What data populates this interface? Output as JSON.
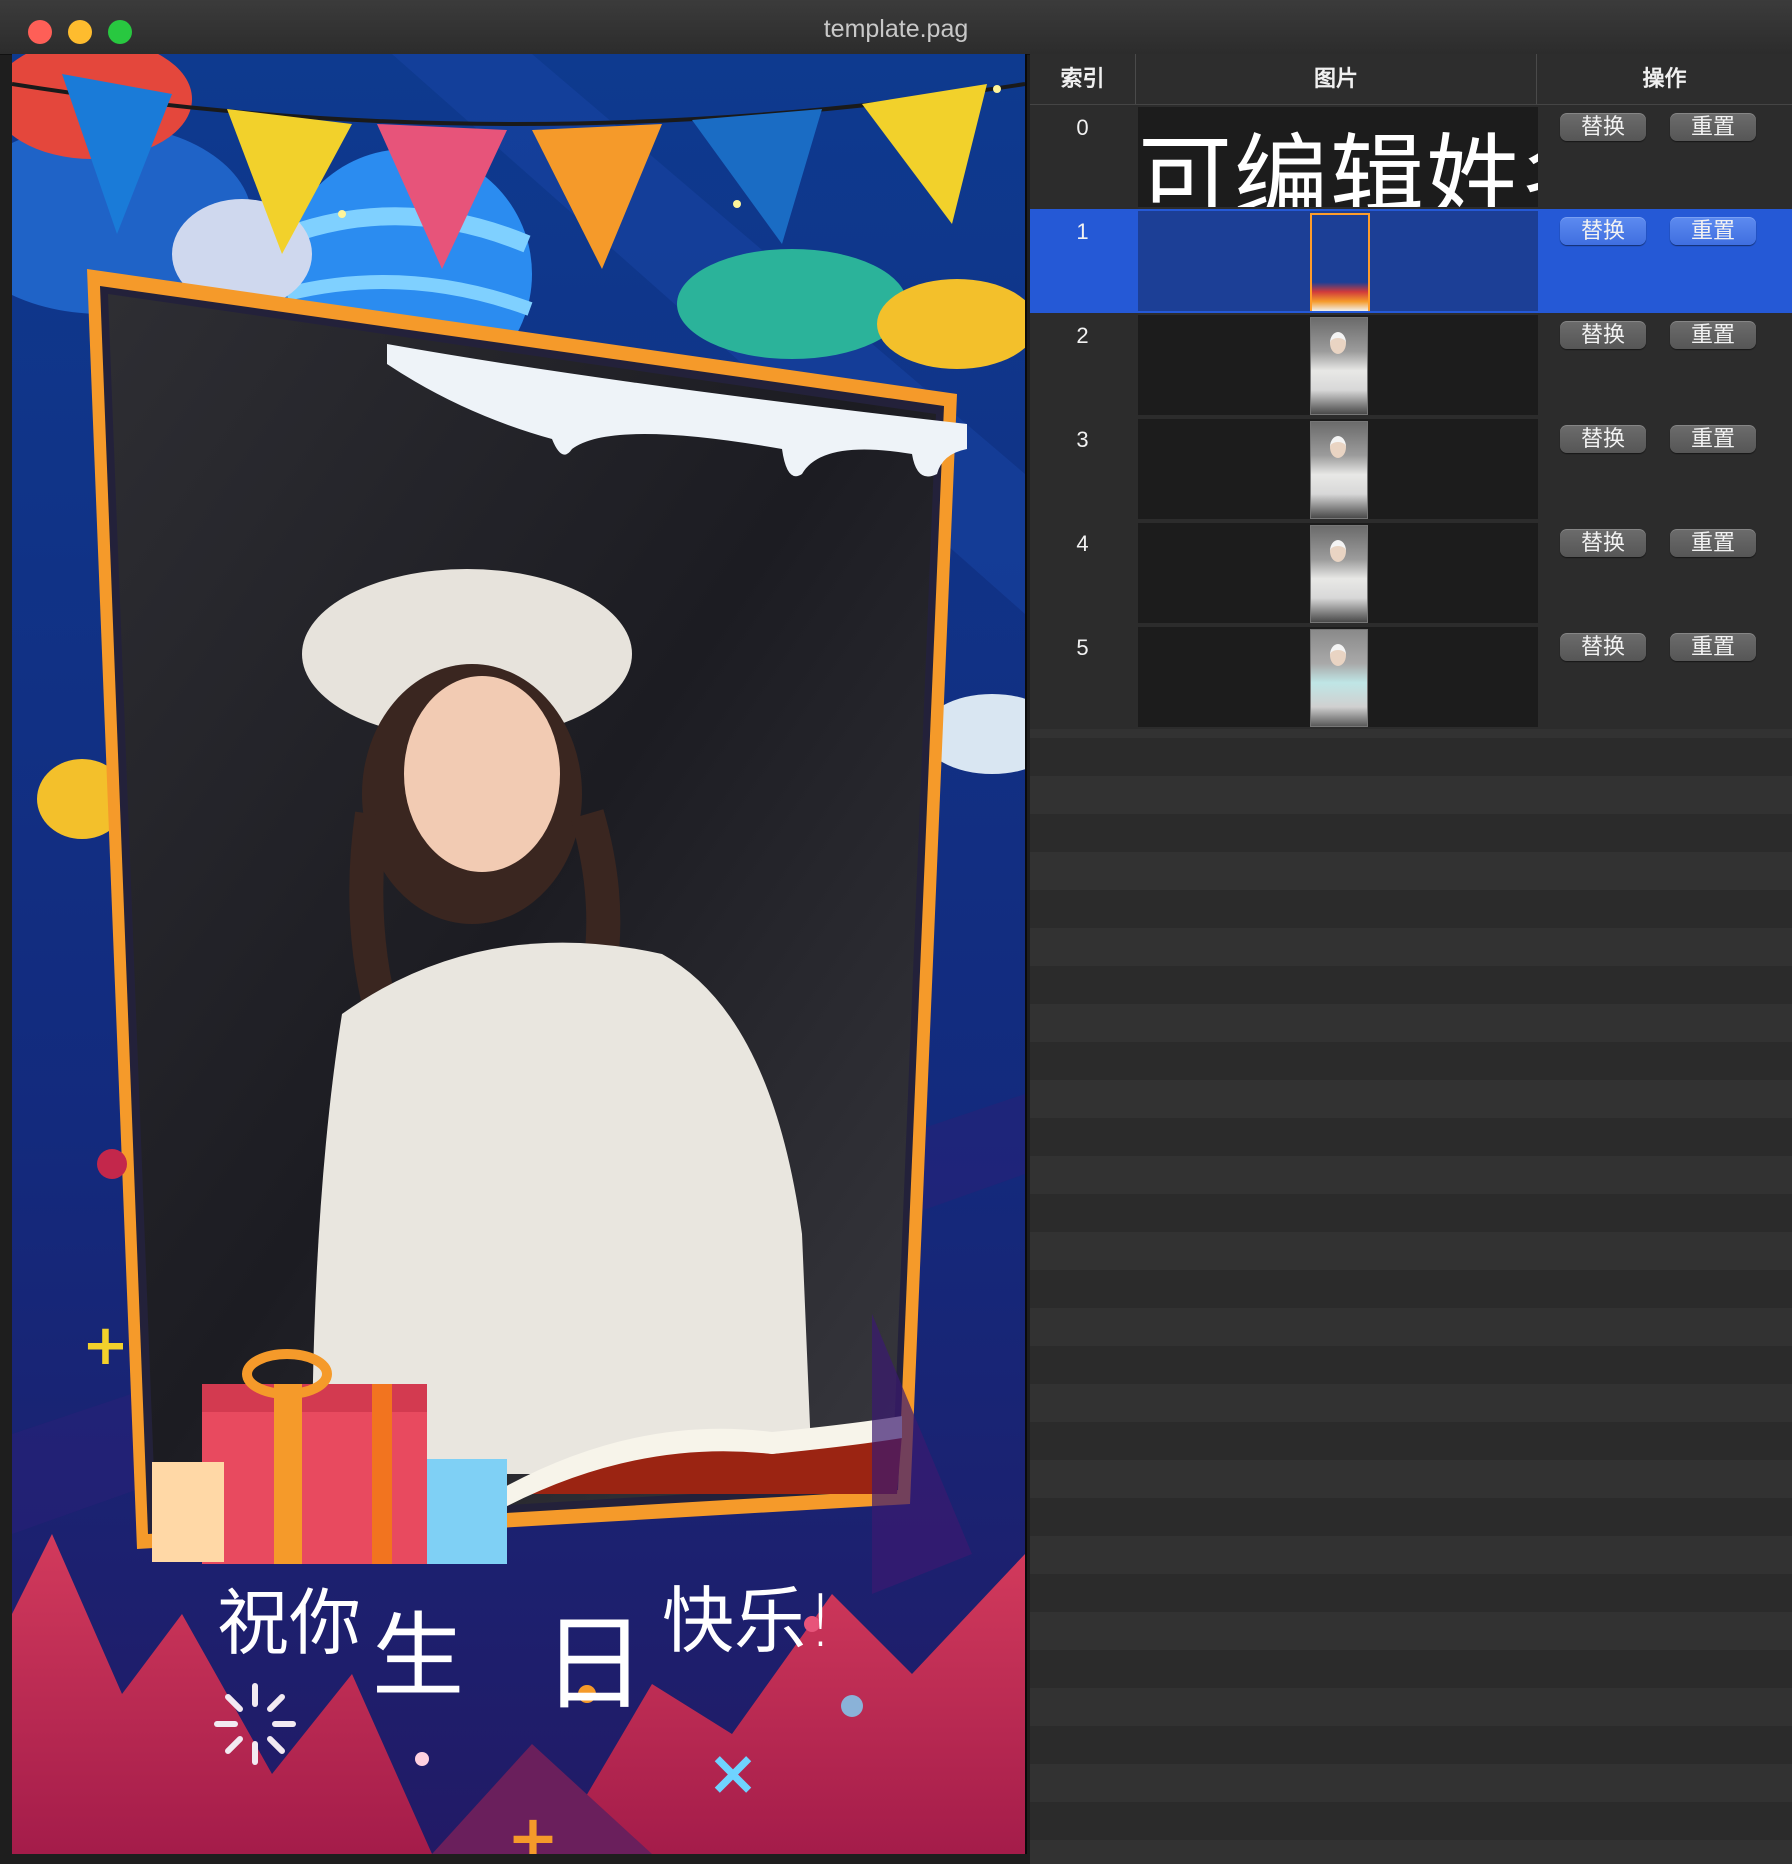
{
  "window": {
    "title": "template.pag"
  },
  "preview": {
    "greeting": [
      "祝你",
      "生",
      "日",
      "快乐!"
    ]
  },
  "table": {
    "columns": {
      "index": "索引",
      "image": "图片",
      "actions": "操作"
    },
    "rows": [
      {
        "index": "0",
        "content": "可编辑姓名",
        "replace": "替换",
        "reset": "重置"
      },
      {
        "index": "1",
        "content": "",
        "replace": "替换",
        "reset": "重置"
      },
      {
        "index": "2",
        "content": "",
        "replace": "替换",
        "reset": "重置"
      },
      {
        "index": "3",
        "content": "",
        "replace": "替换",
        "reset": "重置"
      },
      {
        "index": "4",
        "content": "",
        "replace": "替换",
        "reset": "重置"
      },
      {
        "index": "5",
        "content": "",
        "replace": "替换",
        "reset": "重置"
      }
    ],
    "selected_index": 1
  },
  "colors": {
    "selection": "#2559d6",
    "frame_orange": "#f59a2a",
    "background_blue": "#0f2a7a"
  }
}
